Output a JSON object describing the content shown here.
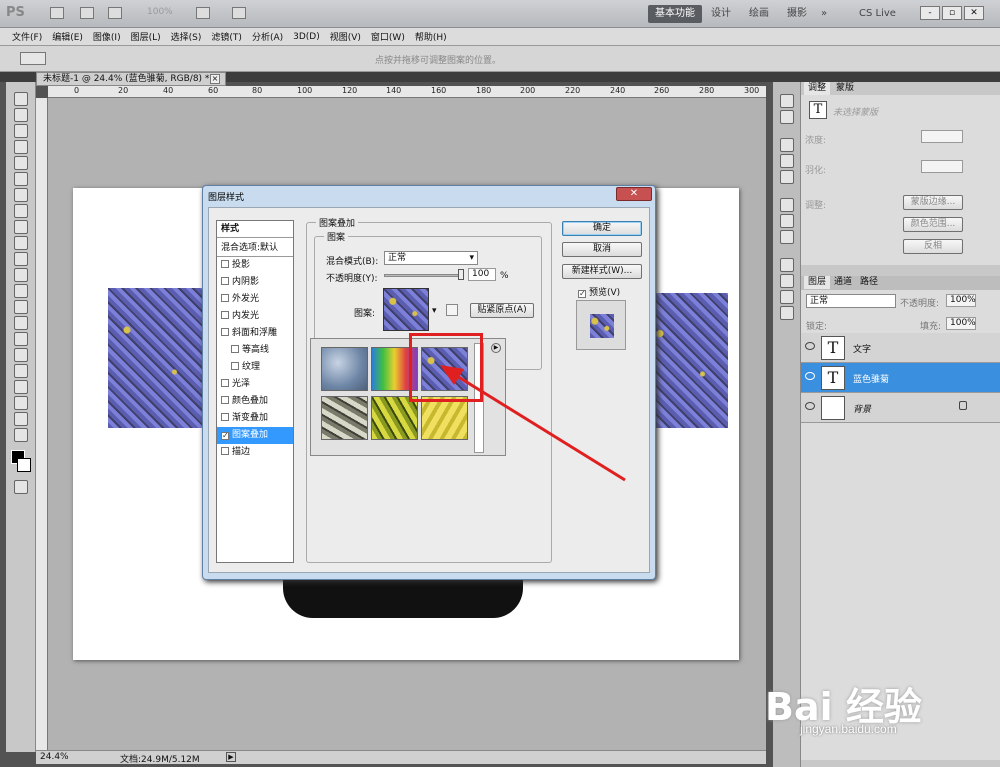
{
  "app": {
    "logo": "PS",
    "zoom": "100%",
    "workspaces": [
      "基本功能",
      "设计",
      "绘画",
      "摄影"
    ],
    "overflow": "»",
    "cs_live": "CS Live",
    "window_controls": [
      "-",
      "▫",
      "✕"
    ]
  },
  "menu": [
    "文件(F)",
    "编辑(E)",
    "图像(I)",
    "图层(L)",
    "选择(S)",
    "滤镜(T)",
    "分析(A)",
    "3D(D)",
    "视图(V)",
    "窗口(W)",
    "帮助(H)"
  ],
  "options_bar": {
    "hint": "点按并拖移可调整图案的位置。"
  },
  "document": {
    "tab_title": "未标题-1 @ 24.4% (蓝色骓菊, RGB/8) *",
    "ruler_labels": [
      "0",
      "20",
      "40",
      "60",
      "80",
      "100",
      "120",
      "140",
      "160",
      "180",
      "200",
      "220",
      "240",
      "260",
      "280",
      "300"
    ]
  },
  "status": {
    "zoom": "24.4%",
    "doc_info": "文档:24.9M/5.12M"
  },
  "dialog": {
    "title": "图层样式",
    "close": "✕",
    "styles_header": "样式",
    "blend_default": "混合选项:默认",
    "style_items": [
      {
        "label": "投影",
        "checked": false
      },
      {
        "label": "内阴影",
        "checked": false
      },
      {
        "label": "外发光",
        "checked": false
      },
      {
        "label": "内发光",
        "checked": false
      },
      {
        "label": "斜面和浮雕",
        "checked": false
      },
      {
        "label": "等高线",
        "checked": false
      },
      {
        "label": "纹理",
        "checked": false
      },
      {
        "label": "光泽",
        "checked": false
      },
      {
        "label": "颜色叠加",
        "checked": false
      },
      {
        "label": "渐变叠加",
        "checked": false
      },
      {
        "label": "图案叠加",
        "checked": true
      },
      {
        "label": "描边",
        "checked": false
      }
    ],
    "section_title": "图案叠加",
    "subsection": "图案",
    "blend_mode_label": "混合模式(B):",
    "blend_mode_value": "正常",
    "opacity_label": "不透明度(Y):",
    "opacity_value": "100",
    "opacity_unit": "%",
    "pattern_label": "图案:",
    "snap_button": "贴紧原点(A)",
    "ok": "确定",
    "cancel": "取消",
    "new_style": "新建样式(W)...",
    "preview_label": "预览(V)",
    "preview_checked": true
  },
  "panels": {
    "adjust_tabs": [
      "调整",
      "蒙版"
    ],
    "mask_status": "未选择蒙版",
    "density_label": "浓度:",
    "feather_label": "羽化:",
    "refine_label": "调整:",
    "mask_edge": "蒙版边缘...",
    "color_range": "颜色范围...",
    "invert": "反相",
    "layer_tabs": [
      "图层",
      "通道",
      "路径"
    ],
    "blend_mode": "正常",
    "opacity_label": "不透明度:",
    "opacity_value": "100%",
    "lock_label": "锁定:",
    "fill_label": "填充:",
    "fill_value": "100%",
    "layers": [
      {
        "name": "文字",
        "thumb": "T",
        "selected": false
      },
      {
        "name": "蓝色骓菊",
        "thumb": "T",
        "selected": true
      },
      {
        "name": "背景",
        "thumb": "",
        "selected": false
      }
    ]
  },
  "watermark": {
    "brand": "Bai 经验",
    "url": "jingyan.baidu.com"
  }
}
